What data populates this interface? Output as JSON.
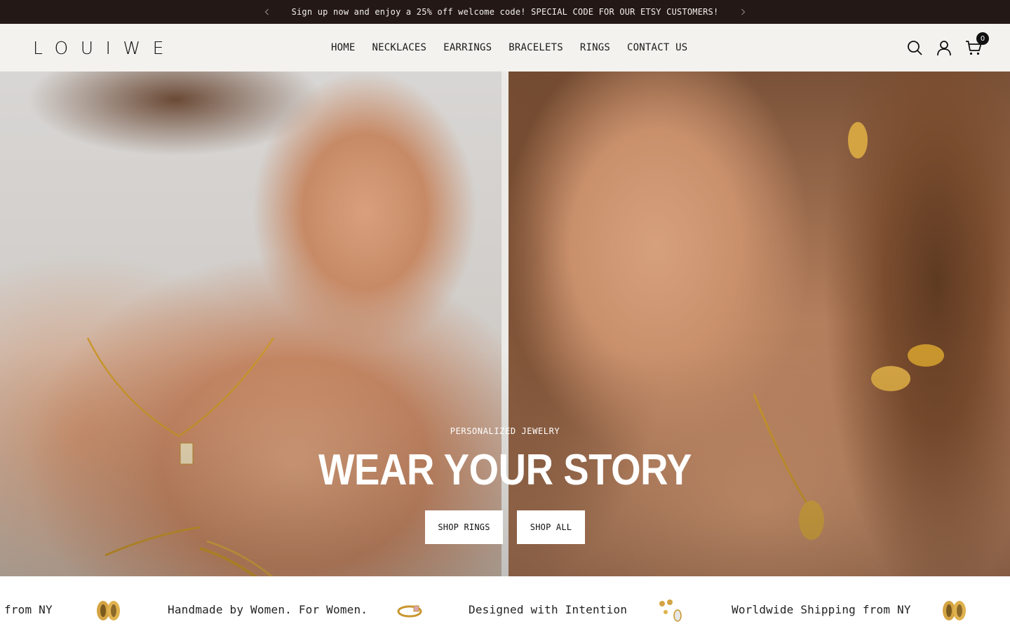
{
  "announcement": {
    "text": "Sign up now and enjoy a 25% off welcome code! SPECIAL CODE FOR OUR ETSY CUSTOMERS!",
    "prev_icon": "chevron-left-icon",
    "next_icon": "chevron-right-icon"
  },
  "header": {
    "logo": "LOUIWE",
    "nav": [
      "HOME",
      "NECKLACES",
      "EARRINGS",
      "BRACELETS",
      "RINGS",
      "CONTACT US"
    ],
    "icons": [
      "search-icon",
      "account-icon",
      "cart-icon"
    ],
    "cart_count": "0"
  },
  "hero": {
    "subtitle": "PERSONALIZED JEWELRY",
    "title": "WEAR YOUR STORY",
    "buttons": [
      "SHOP RINGS",
      "SHOP ALL"
    ]
  },
  "marquee": {
    "items": [
      "from NY",
      "Handmade by Women. For Women.",
      "Designed with Intention",
      "Worldwide Shipping from NY"
    ],
    "icons": [
      "gold-earrings-icon",
      "ring-icon",
      "drop-earrings-icon",
      "gold-earrings-icon"
    ]
  },
  "colors": {
    "announcement_bg": "#231816",
    "header_bg": "#f3f2ee",
    "gold": "#c9962e"
  }
}
